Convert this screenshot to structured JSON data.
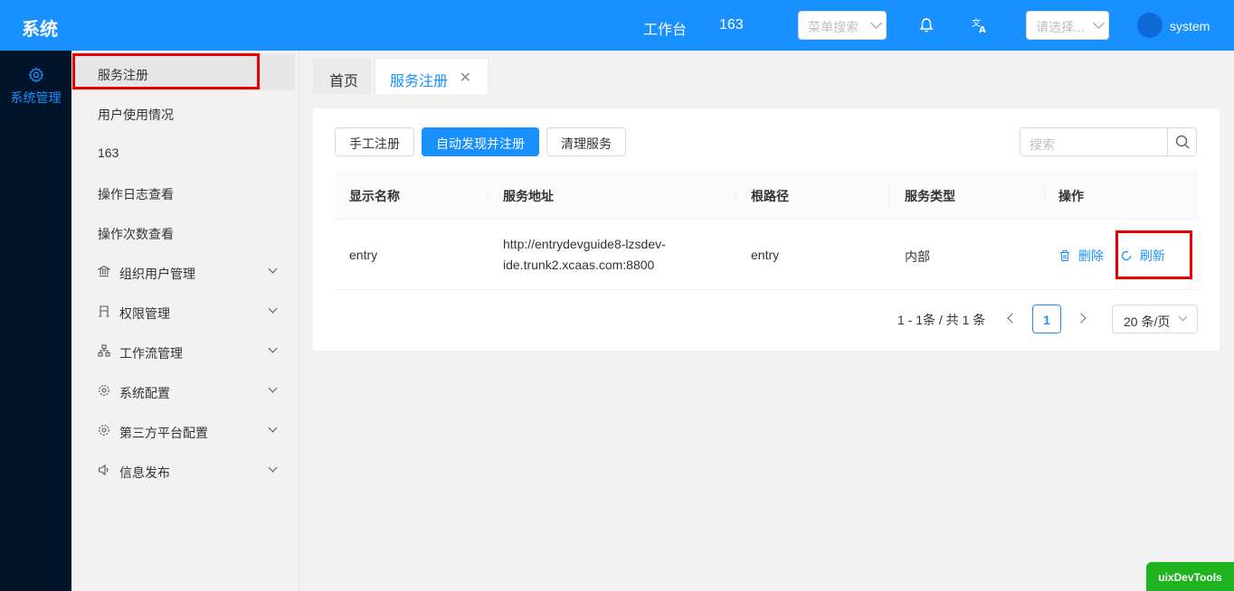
{
  "header": {
    "title": "系统",
    "workbench": "工作台",
    "count": "163",
    "menu_search_placeholder": "菜单搜索",
    "select_placeholder": "请选择...",
    "username": "system"
  },
  "rail": {
    "label": "系统管理"
  },
  "sidebar": {
    "items": [
      {
        "label": "服务注册"
      },
      {
        "label": "用户使用情况"
      },
      {
        "label": "163"
      },
      {
        "label": "操作日志查看"
      },
      {
        "label": "操作次数查看"
      },
      {
        "label": "组织用户管理"
      },
      {
        "label": "权限管理"
      },
      {
        "label": "工作流管理"
      },
      {
        "label": "系统配置"
      },
      {
        "label": "第三方平台配置"
      },
      {
        "label": "信息发布"
      }
    ]
  },
  "tabs": [
    {
      "label": "首页"
    },
    {
      "label": "服务注册"
    }
  ],
  "toolbar": {
    "manual": "手工注册",
    "auto": "自动发现并注册",
    "clean": "清理服务",
    "search_placeholder": "搜索"
  },
  "table": {
    "columns": [
      "显示名称",
      "服务地址",
      "根路径",
      "服务类型",
      "操作"
    ],
    "rows": [
      {
        "name": "entry",
        "address_line1": "http://entrydevguide8-lzsdev-",
        "address_line2": "ide.trunk2.xcaas.com:8800",
        "root": "entry",
        "type": "内部",
        "delete": "删除",
        "refresh": "刷新"
      }
    ]
  },
  "pagination": {
    "total": "1 - 1条 / 共 1 条",
    "current": "1",
    "page_size": "20 条/页"
  },
  "devtools": "uixDevTools",
  "colors": {
    "primary": "#1890ff",
    "rail": "#001529",
    "highlight": "#e60000"
  }
}
